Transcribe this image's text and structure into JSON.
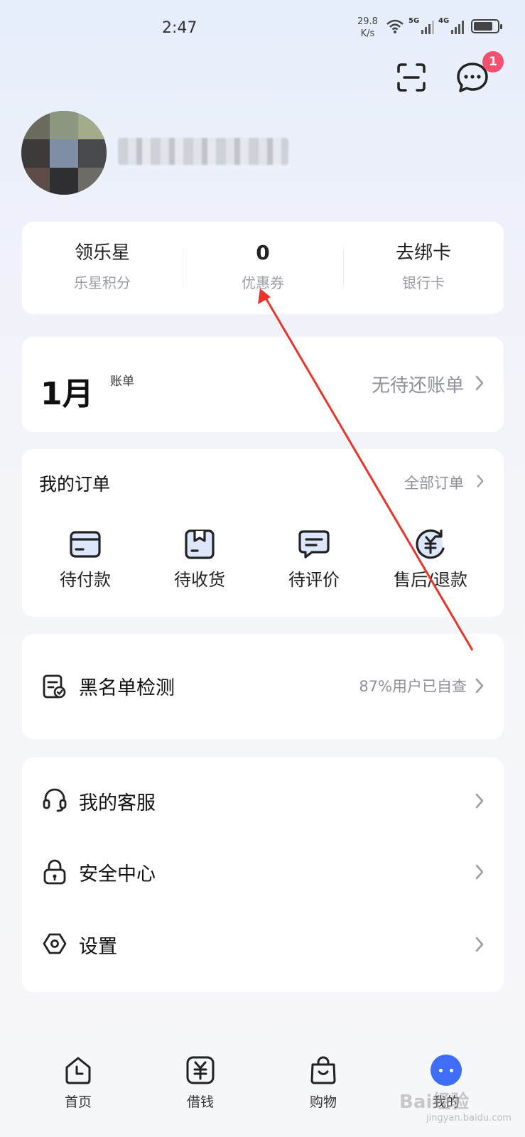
{
  "status_bar": {
    "time": "2:47",
    "net_speed_value": "29.8",
    "net_speed_unit": "K/s",
    "signal_1": "5G",
    "signal_2": "4G"
  },
  "header": {
    "scan_icon": "scan-icon",
    "message_icon": "message-icon",
    "message_badge": "1",
    "username": "1**********"
  },
  "stats": [
    {
      "value": "领乐星",
      "label": "乐星积分"
    },
    {
      "value": "0",
      "label": "优惠券"
    },
    {
      "value": "去绑卡",
      "label": "银行卡"
    }
  ],
  "bill": {
    "month": "1月",
    "label": "账单",
    "status": "无待还账单"
  },
  "orders": {
    "title": "我的订单",
    "all_label": "全部订单",
    "items": [
      {
        "label": "待付款",
        "icon": "card-icon"
      },
      {
        "label": "待收货",
        "icon": "box-icon"
      },
      {
        "label": "待评价",
        "icon": "comment-icon"
      },
      {
        "label": "售后/退款",
        "icon": "refund-icon"
      }
    ]
  },
  "blacklist": {
    "title": "黑名单检测",
    "hint": "87%用户已自查",
    "icon": "document-check-icon"
  },
  "menu": [
    {
      "label": "我的客服",
      "icon": "headset-icon"
    },
    {
      "label": "安全中心",
      "icon": "lock-icon"
    },
    {
      "label": "设置",
      "icon": "settings-icon"
    }
  ],
  "tabbar": [
    {
      "label": "首页",
      "icon": "home-icon",
      "active": false
    },
    {
      "label": "借钱",
      "icon": "yuan-icon",
      "active": false
    },
    {
      "label": "购物",
      "icon": "shopping-bag-icon",
      "active": false
    },
    {
      "label": "我的",
      "icon": "profile-dots-icon",
      "active": true
    }
  ],
  "watermark": {
    "text": "Bai经验",
    "sub": "jingyan.baidu.com"
  },
  "colors": {
    "accent": "#3d6ef5",
    "badge": "#f2506e",
    "annotation_arrow": "#e8352b",
    "muted_text": "#8e9199"
  }
}
